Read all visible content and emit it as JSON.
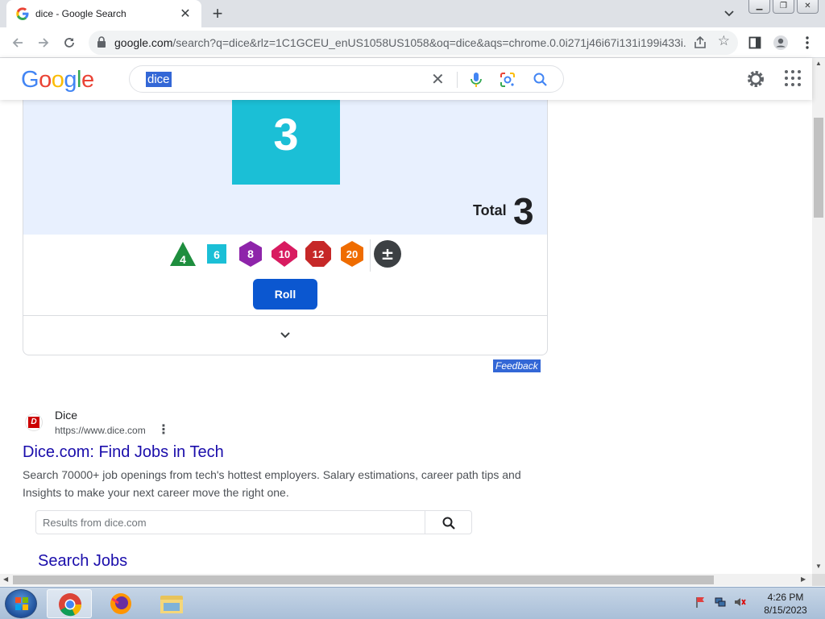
{
  "browser": {
    "tab_title": "dice - Google Search",
    "tab_close": "✕",
    "new_tab": "+",
    "url_host": "google.com",
    "url_path": "/search?q=dice&rlz=1C1GCEU_enUS1058US1058&oq=dice&aqs=chrome.0.0i271j46i67i131i199i433i..."
  },
  "google": {
    "logo_letters": [
      "G",
      "o",
      "o",
      "g",
      "l",
      "e"
    ],
    "logo_colors": [
      "#4285f4",
      "#ea4335",
      "#fbbc05",
      "#4285f4",
      "#34a853",
      "#ea4335"
    ],
    "query": "dice"
  },
  "dice_widget": {
    "rolled_value": "3",
    "total_label": "Total",
    "total_value": "3",
    "dice": [
      {
        "label": "4",
        "color": "#1e8e3e",
        "shape": "triangle"
      },
      {
        "label": "6",
        "color": "#1bbfd6",
        "shape": "square"
      },
      {
        "label": "8",
        "color": "#8e24aa",
        "shape": "hexagon"
      },
      {
        "label": "10",
        "color": "#d81b60",
        "shape": "diamond"
      },
      {
        "label": "12",
        "color": "#c62828",
        "shape": "octagon"
      },
      {
        "label": "20",
        "color": "#ef6c00",
        "shape": "hexagon"
      }
    ],
    "modifier_label": "±",
    "roll_label": "Roll"
  },
  "feedback_label": "Feedback",
  "result": {
    "favicon_letter": "D",
    "site_name": "Dice",
    "url": "https://www.dice.com",
    "title": "Dice.com: Find Jobs in Tech",
    "snippet": "Search 70000+ job openings from tech's hottest employers. Salary estimations, career path tips and Insights to make your next career move the right one.",
    "site_search_placeholder": "Results from dice.com",
    "sublink": "Search Jobs"
  },
  "taskbar": {
    "time": "4:26 PM",
    "date": "8/15/2023"
  }
}
